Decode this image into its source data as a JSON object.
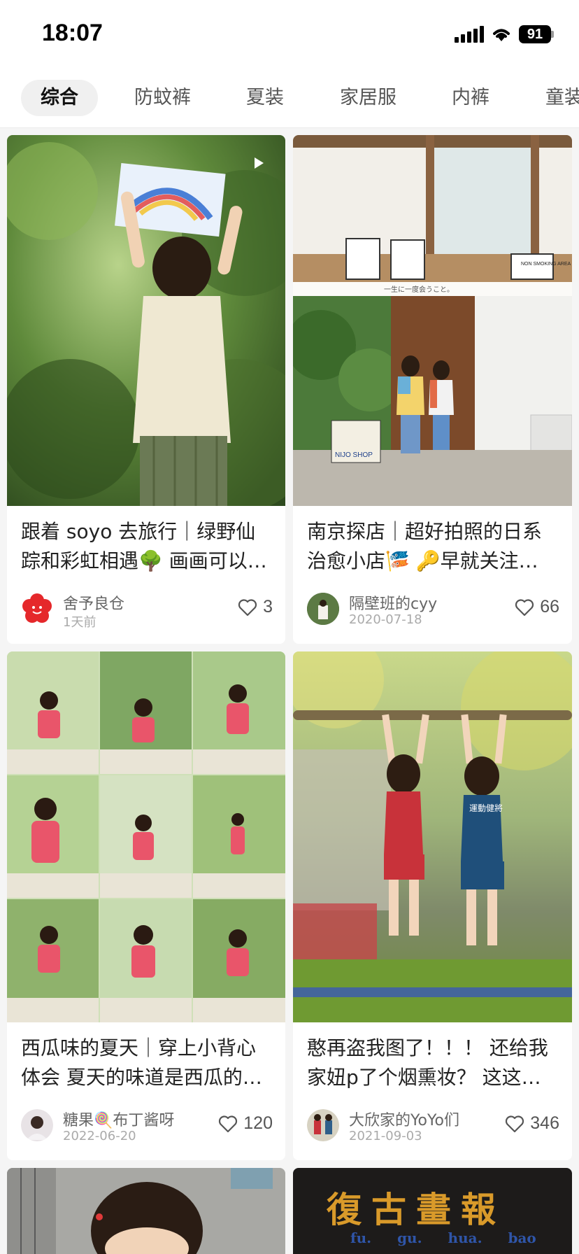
{
  "status_bar": {
    "time": "18:07",
    "battery": "91",
    "icons": [
      "signal-icon",
      "wifi-icon",
      "battery-icon"
    ]
  },
  "tabs": [
    {
      "label": "综合",
      "active": true
    },
    {
      "label": "防蚊裤",
      "active": false
    },
    {
      "label": "夏装",
      "active": false
    },
    {
      "label": "家居服",
      "active": false
    },
    {
      "label": "内裤",
      "active": false
    },
    {
      "label": "童装",
      "active": false
    }
  ],
  "posts": [
    {
      "title": "跟着 soyo 去旅行｜绿野仙踪和彩虹相遇🌳 画画可以…",
      "author": "舍予良仓",
      "date": "1天前",
      "likes": "3",
      "is_video": true,
      "image_icon": "child-drawing-rainbow-photo"
    },
    {
      "title": "南京探店｜超好拍照的日系治愈小店🎏 🔑早就关注…",
      "author": "隔壁班的cyy",
      "date": "2020-07-18",
      "likes": "66",
      "is_video": false,
      "image_icon": "shop-collage-photo",
      "image_texts": {
        "collage_tagline": "一生に一度会うこと。",
        "sign_text": "NIJO SHOP",
        "poster_text": "NON SMOKING AREA"
      }
    },
    {
      "title": "西瓜味的夏天｜穿上小背心 体会 夏天的味道是西瓜的…",
      "author": "糖果🍭布丁酱呀",
      "date": "2022-06-20",
      "likes": "120",
      "is_video": false,
      "image_icon": "watermelon-girl-grid-photo"
    },
    {
      "title": "憨再盗我图了！！！ 还给我家妞p了个烟熏妆？ 这这…",
      "author": "大欣家的YoYo们",
      "date": "2021-09-03",
      "likes": "346",
      "is_video": false,
      "image_icon": "kids-hanging-bar-photo",
      "image_texts": {
        "shirt_text": "運動健將"
      }
    },
    {
      "image_icon": "girl-portrait-photo"
    },
    {
      "image_icon": "vintage-magazine-photo",
      "image_texts": {
        "headline": "復古畫報",
        "subline": "fu. gu. hua. bao"
      }
    }
  ],
  "colors": {
    "background": "#f5f5f5",
    "card": "#ffffff",
    "tab_active_bg": "#f0f0f0",
    "text_primary": "#222222",
    "text_secondary": "#666666"
  }
}
